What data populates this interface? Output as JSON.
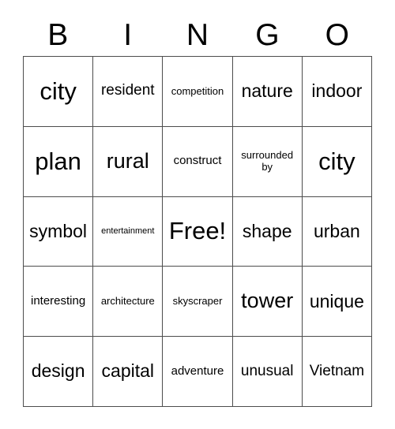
{
  "card": {
    "title": "BINGO",
    "header_letters": [
      "B",
      "I",
      "N",
      "G",
      "O"
    ],
    "free_space_label": "Free!",
    "grid_size": "5x5",
    "colors": {
      "border": "#4d4d4d",
      "text": "#000000",
      "background": "#ffffff"
    },
    "cells": [
      [
        {
          "text": "city",
          "size": "fs-xxl"
        },
        {
          "text": "resident",
          "size": "fs-md"
        },
        {
          "text": "competition",
          "size": "fs-xs"
        },
        {
          "text": "nature",
          "size": "fs-lg"
        },
        {
          "text": "indoor",
          "size": "fs-lg"
        }
      ],
      [
        {
          "text": "plan",
          "size": "fs-xxl"
        },
        {
          "text": "rural",
          "size": "fs-xl"
        },
        {
          "text": "construct",
          "size": "fs-sm"
        },
        {
          "text": "surrounded by",
          "size": "fs-xs"
        },
        {
          "text": "city",
          "size": "fs-xxl"
        }
      ],
      [
        {
          "text": "symbol",
          "size": "fs-lg"
        },
        {
          "text": "entertainment",
          "size": "fs-xxs"
        },
        {
          "text": "Free!",
          "size": "fs-xxl"
        },
        {
          "text": "shape",
          "size": "fs-lg"
        },
        {
          "text": "urban",
          "size": "fs-lg"
        }
      ],
      [
        {
          "text": "interesting",
          "size": "fs-sm"
        },
        {
          "text": "architecture",
          "size": "fs-xs"
        },
        {
          "text": "skyscraper",
          "size": "fs-xs"
        },
        {
          "text": "tower",
          "size": "fs-xl"
        },
        {
          "text": "unique",
          "size": "fs-lg"
        }
      ],
      [
        {
          "text": "design",
          "size": "fs-lg"
        },
        {
          "text": "capital",
          "size": "fs-lg"
        },
        {
          "text": "adventure",
          "size": "fs-sm"
        },
        {
          "text": "unusual",
          "size": "fs-md"
        },
        {
          "text": "Vietnam",
          "size": "fs-md"
        }
      ]
    ]
  }
}
